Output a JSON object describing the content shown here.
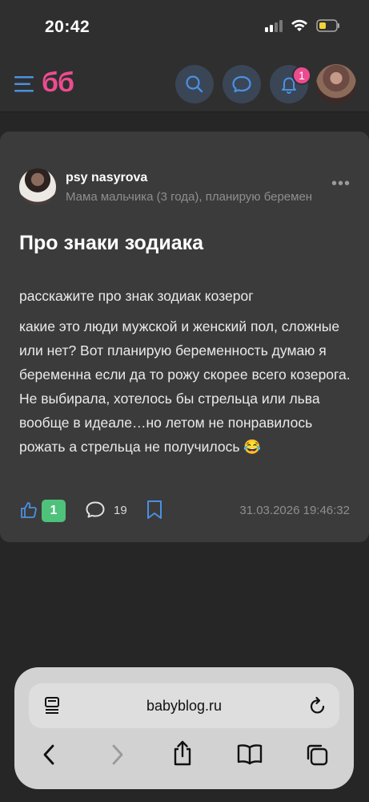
{
  "status": {
    "time": "20:42"
  },
  "header": {
    "logo": "бб",
    "notifications_count": "1"
  },
  "post": {
    "author": "psy nasyrova",
    "author_description": "Мама мальчика (3 года), планирую беремен",
    "title": "Про знаки зодиака",
    "paragraph1": "расскажите про знак зодиак козерог",
    "paragraph2": "какие это люди мужской и женский пол, сложные или нет? Вот планирую беременность думаю я беременна если да то рожу скорее всего козерога. Не выбирала, хотелось бы стрельца или льва вообще в идеале…но летом не понравилось рожать а стрельца не получилось 😂",
    "likes": "1",
    "comments": "19",
    "date": "31.03.2026 19:46:32"
  },
  "browser": {
    "url": "babyblog.ru"
  },
  "colors": {
    "brand": "#ec4c8f",
    "like_badge": "#4ec27a",
    "icon_accent": "#4a90e2"
  }
}
